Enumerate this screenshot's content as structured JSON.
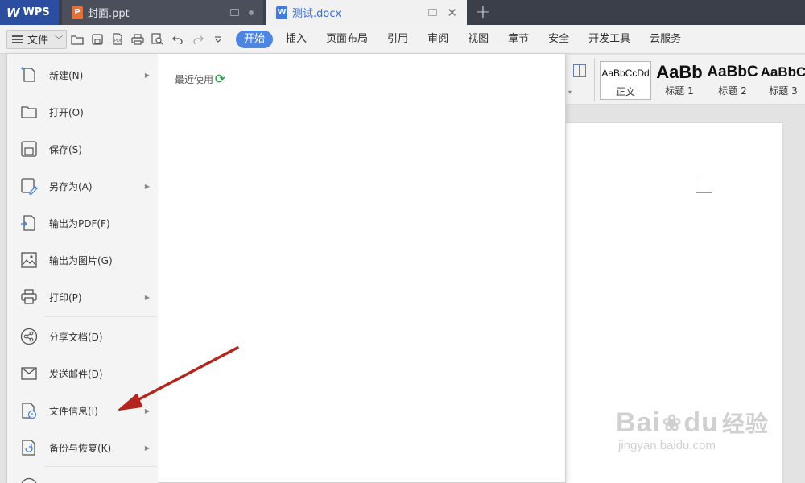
{
  "titlebar": {
    "app_tab": "WPS",
    "tabs": [
      {
        "label": "封面.ppt",
        "badge": "P"
      },
      {
        "label": "测试.docx",
        "badge": "W"
      }
    ],
    "new_tab_label": "+",
    "close_label": "✕"
  },
  "toolbar": {
    "file_label": "文件",
    "ribbon_tabs": [
      "开始",
      "插入",
      "页面布局",
      "引用",
      "审阅",
      "视图",
      "章节",
      "安全",
      "开发工具",
      "云服务"
    ],
    "active_tab": "开始",
    "quick_icons": [
      "open-folder-icon",
      "save-icon",
      "pdf-icon",
      "print-icon",
      "print-preview-icon",
      "undo-icon",
      "redo-icon",
      "customize-icon"
    ]
  },
  "styles": {
    "items": [
      {
        "sample": "AaBbCcDd",
        "name": "正文"
      },
      {
        "sample": "AaBb",
        "name": "标题 1"
      },
      {
        "sample": "AaBbC",
        "name": "标题 2"
      },
      {
        "sample": "AaBbC",
        "name": "标题 3"
      }
    ]
  },
  "file_menu": {
    "items": [
      {
        "label": "新建(N)",
        "icon": "new-file-icon",
        "submenu": true
      },
      {
        "label": "打开(O)",
        "icon": "open-folder-icon",
        "submenu": false
      },
      {
        "label": "保存(S)",
        "icon": "save-icon",
        "submenu": false
      },
      {
        "label": "另存为(A)",
        "icon": "save-as-icon",
        "submenu": true
      },
      {
        "label": "输出为PDF(F)",
        "icon": "export-pdf-icon",
        "submenu": false
      },
      {
        "label": "输出为图片(G)",
        "icon": "export-image-icon",
        "submenu": false
      },
      {
        "label": "打印(P)",
        "icon": "print-icon",
        "submenu": true
      },
      {
        "label": "分享文档(D)",
        "icon": "share-icon",
        "submenu": false
      },
      {
        "label": "发送邮件(D)",
        "icon": "mail-icon",
        "submenu": false
      },
      {
        "label": "文件信息(I)",
        "icon": "file-info-icon",
        "submenu": true
      },
      {
        "label": "备份与恢复(K)",
        "icon": "backup-restore-icon",
        "submenu": true
      }
    ],
    "recent_title": "最近使用"
  },
  "watermark": {
    "main": "Bai",
    "main2": "du",
    "cn": "经验",
    "sub": "jingyan.baidu.com"
  },
  "colors": {
    "accent": "#4d85e3",
    "titlebar": "#3b3f4a",
    "annotation": "#b3261e"
  }
}
